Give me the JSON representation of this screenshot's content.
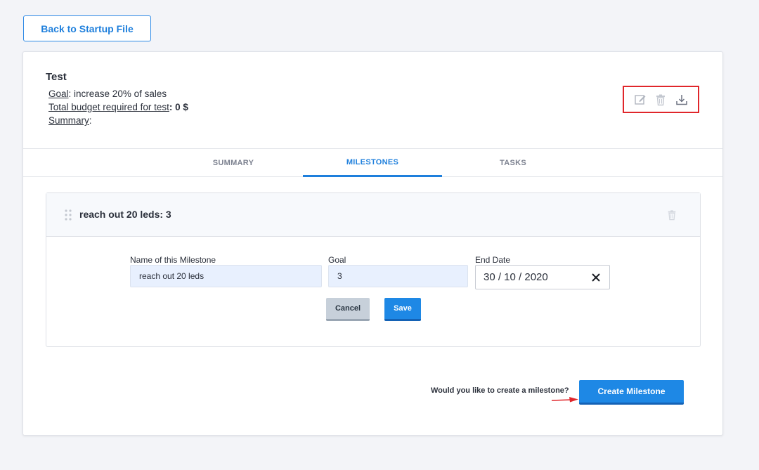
{
  "back_button": {
    "label": "Back to Startup File"
  },
  "test": {
    "title": "Test",
    "goal_key": "Goal",
    "goal_value": ": increase 20% of sales",
    "budget_key": "Total budget required for test",
    "budget_value": ": 0 $",
    "summary_key": "Summary",
    "summary_value": ":"
  },
  "actions": {
    "icons": [
      "edit-icon",
      "trash-icon",
      "download-icon"
    ],
    "highlight_color": "#e0262b"
  },
  "tabs": [
    {
      "label": "SUMMARY",
      "active": false
    },
    {
      "label": "MILESTONES",
      "active": true
    },
    {
      "label": "TASKS",
      "active": false
    }
  ],
  "milestone": {
    "header_title": "reach out 20 leds: 3",
    "name_label": "Name of this Milestone",
    "name_value": "reach out 20 leds",
    "goal_label": "Goal",
    "goal_value": "3",
    "end_date_label": "End Date",
    "end_date_value": "30 / 10 / 2020",
    "cancel_label": "Cancel",
    "save_label": "Save"
  },
  "create": {
    "prompt": "Would you like to create a milestone?",
    "button_label": "Create Milestone"
  },
  "colors": {
    "accent": "#1e88e5",
    "background": "#f3f4f8",
    "arrow": "#e0262b"
  }
}
